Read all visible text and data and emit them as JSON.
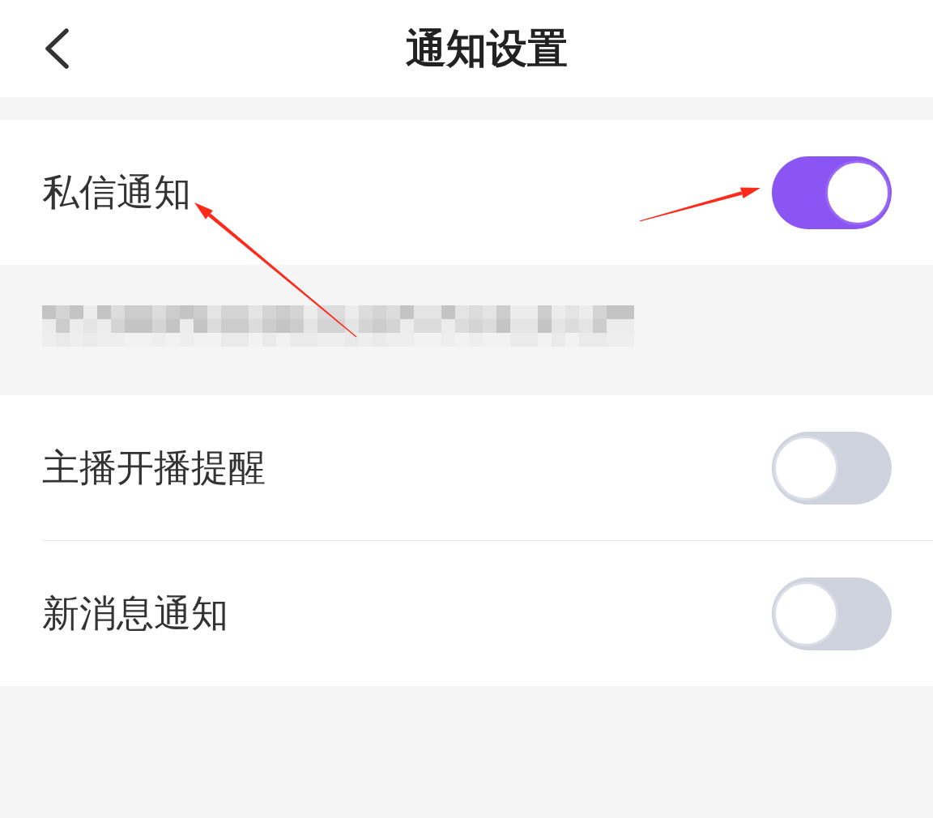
{
  "header": {
    "title": "通知设置"
  },
  "groups": [
    {
      "rows": [
        {
          "label": "私信通知",
          "on": true
        }
      ]
    },
    {
      "rows": [
        {
          "label": "主播开播提醒",
          "on": false
        },
        {
          "label": "新消息通知",
          "on": false
        }
      ]
    }
  ]
}
